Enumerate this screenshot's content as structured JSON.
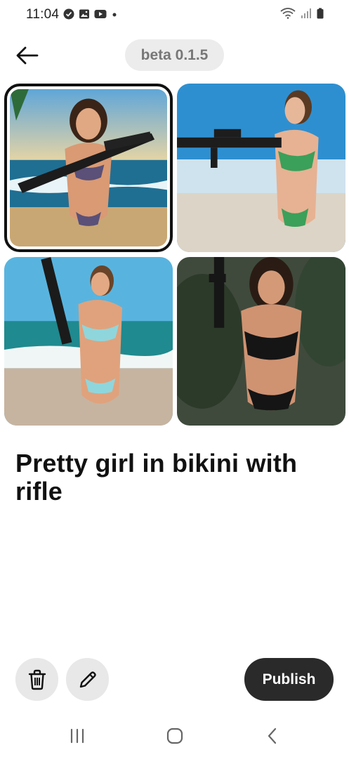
{
  "status_bar": {
    "time": "11:04",
    "left_icons": [
      "check-circle-icon",
      "image-icon",
      "youtube-icon",
      "dot-icon"
    ],
    "right_icons": [
      "wifi-icon",
      "signal-icon",
      "battery-icon"
    ]
  },
  "header": {
    "back_icon": "arrow-left-icon",
    "version": "beta 0.1.5"
  },
  "images": [
    {
      "name": "generated-image-1",
      "selected": true
    },
    {
      "name": "generated-image-2",
      "selected": false
    },
    {
      "name": "generated-image-3",
      "selected": false
    },
    {
      "name": "generated-image-4",
      "selected": false
    }
  ],
  "prompt_title": "Pretty girl in bikini with rifle",
  "actions": {
    "delete_icon": "trash-icon",
    "edit_icon": "pencil-icon",
    "publish_label": "Publish"
  },
  "system_nav": [
    "recents-icon",
    "home-icon",
    "back-icon"
  ],
  "colors": {
    "pill_bg": "#ececec",
    "pill_text": "#777777",
    "publish_bg": "#2a2a2a",
    "round_btn_bg": "#e8e8e8"
  }
}
